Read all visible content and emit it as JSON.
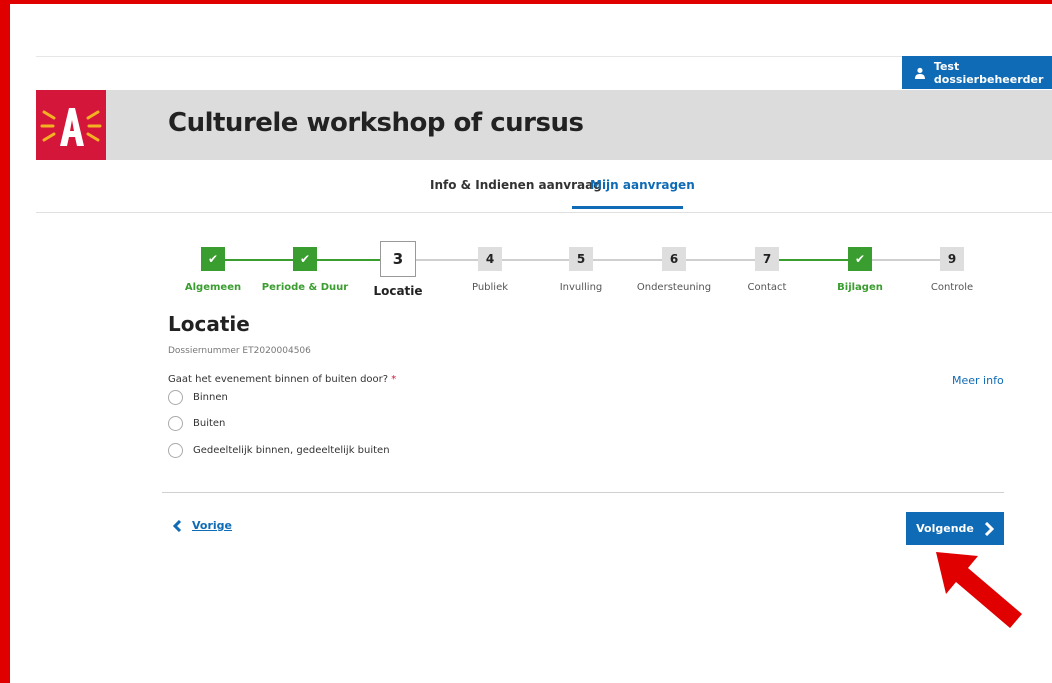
{
  "header": {
    "user_label": "Test dossierbeheerder",
    "title": "Culturele workshop of cursus",
    "brand_color": "#d3163a",
    "accent_color": "#0f6bb5"
  },
  "tabs": [
    {
      "label": "Info & Indienen aanvraag",
      "active": false
    },
    {
      "label": "Mijn aanvragen",
      "active": true
    }
  ],
  "steps": [
    {
      "number": "1",
      "label": "Algemeen",
      "state": "done"
    },
    {
      "number": "2",
      "label": "Periode & Duur",
      "state": "done"
    },
    {
      "number": "3",
      "label": "Locatie",
      "state": "current"
    },
    {
      "number": "4",
      "label": "Publiek",
      "state": "todo"
    },
    {
      "number": "5",
      "label": "Invulling",
      "state": "todo"
    },
    {
      "number": "6",
      "label": "Ondersteuning",
      "state": "todo"
    },
    {
      "number": "7",
      "label": "Contact",
      "state": "todo"
    },
    {
      "number": "8",
      "label": "Bijlagen",
      "state": "done"
    },
    {
      "number": "9",
      "label": "Controle",
      "state": "todo"
    }
  ],
  "form": {
    "section_title": "Locatie",
    "dossier_number": "Dossiernummer ET2020004506",
    "question": "Gaat het evenement binnen of buiten door?",
    "required_marker": "*",
    "meer_info": "Meer info",
    "options": [
      "Binnen",
      "Buiten",
      "Gedeeltelijk binnen, gedeeltelijk buiten"
    ]
  },
  "nav": {
    "prev_label": "Vorige",
    "next_label": "Volgende"
  }
}
